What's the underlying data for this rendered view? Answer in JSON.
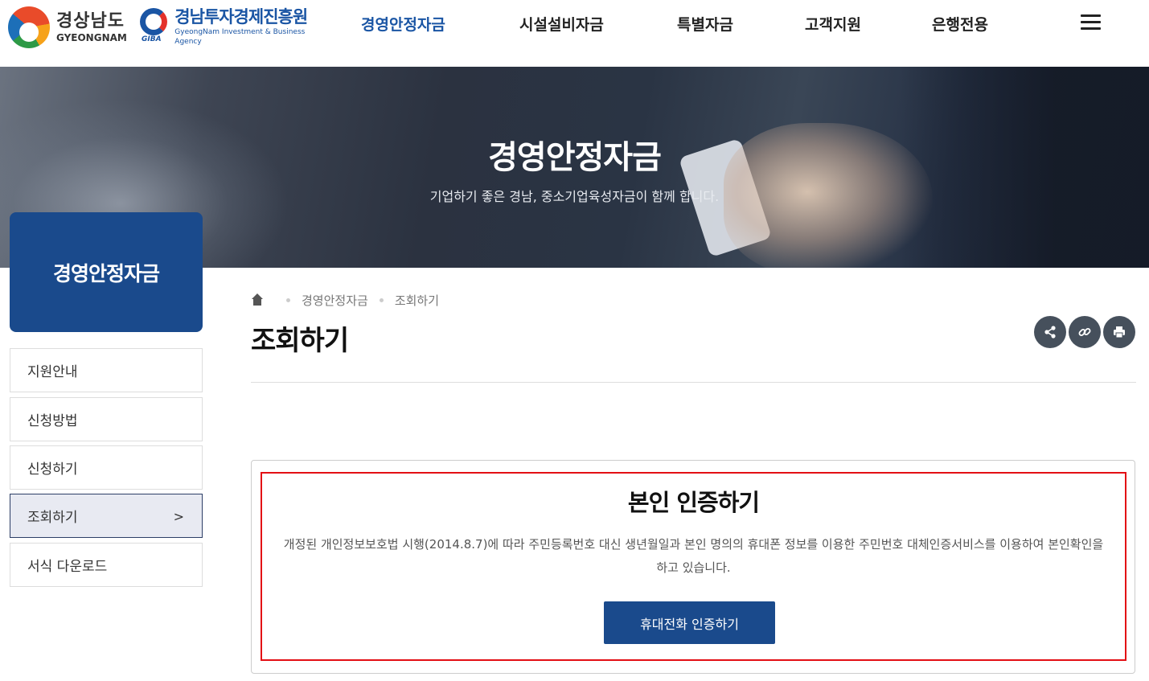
{
  "header": {
    "logo1": {
      "ko": "경상남도",
      "en": "GYEONGNAM"
    },
    "logo2": {
      "ko": "경남투자경제진흥원",
      "en": "GyeongNam Investment & Business Agency",
      "mark": "GIBA"
    },
    "nav": [
      {
        "label": "경영안정자금",
        "active": true
      },
      {
        "label": "시설설비자금",
        "active": false
      },
      {
        "label": "특별자금",
        "active": false
      },
      {
        "label": "고객지원",
        "active": false
      },
      {
        "label": "은행전용",
        "active": false
      }
    ],
    "menu_icon": "hamburger-menu-icon"
  },
  "banner": {
    "title": "경영안정자금",
    "subtitle": "기업하기 좋은 경남, 중소기업육성자금이 함께 합니다."
  },
  "sidebar": {
    "title": "경영안정자금",
    "items": [
      {
        "label": "지원안내",
        "active": false
      },
      {
        "label": "신청방법",
        "active": false
      },
      {
        "label": "신청하기",
        "active": false
      },
      {
        "label": "조회하기",
        "active": true
      },
      {
        "label": "서식 다운로드",
        "active": false
      }
    ],
    "active_arrow": ">"
  },
  "breadcrumb": {
    "home_icon": "home-icon",
    "items": [
      "경영안정자금",
      "조회하기"
    ]
  },
  "page": {
    "title": "조회하기",
    "utils": [
      {
        "icon": "share-icon",
        "glyph": "⋖"
      },
      {
        "icon": "link-icon",
        "glyph": "⛓"
      },
      {
        "icon": "print-icon",
        "glyph": "⎙"
      }
    ]
  },
  "auth": {
    "title": "본인 인증하기",
    "description": "개정된 개인정보보호법 시행(2014.8.7)에 따라 주민등록번호 대신 생년월일과 본인 명의의 휴대폰 정보를 이용한 주민번호 대체인증서비스를 이용하여 본인확인을 하고 있습니다.",
    "button_label": "휴대전화 인증하기"
  },
  "colors": {
    "brand_blue": "#1a4a8c",
    "nav_active": "#1a55a4",
    "highlight_red": "#e30f14",
    "util_button": "#46505c"
  }
}
